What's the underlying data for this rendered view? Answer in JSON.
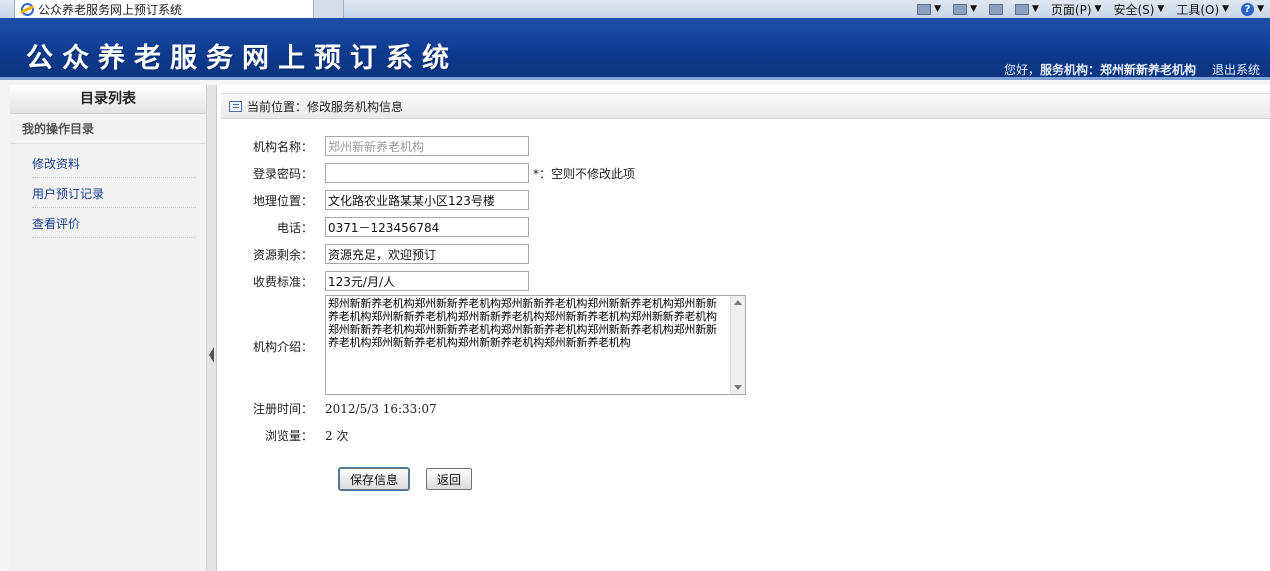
{
  "browser": {
    "tab_title": "公众养老服务网上预订系统",
    "menu": {
      "page": "页面(P)",
      "safety": "安全(S)",
      "tools": "工具(O)"
    }
  },
  "header": {
    "site_title": "公众养老服务网上预订系统",
    "greeting": "您好，",
    "user_role_name": "服务机构：郑州新新养老机构",
    "logout": "退出系统"
  },
  "sidebar": {
    "title": "目录列表",
    "section": "我的操作目录",
    "items": [
      "修改资料",
      "用户预订记录",
      "查看评价"
    ]
  },
  "breadcrumb": {
    "text": "当前位置：修改服务机构信息"
  },
  "form": {
    "name_label": "机构名称：",
    "name_value": "郑州新新养老机构",
    "password_label": "登录密码：",
    "password_value": "",
    "password_hint": "*：空则不修改此项",
    "address_label": "地理位置：",
    "address_value": "文化路农业路某某小区123号楼",
    "phone_label": "电话：",
    "phone_value": "0371－123456784",
    "resource_label": "资源剩余：",
    "resource_value": "资源充足，欢迎预订",
    "fee_label": "收费标准：",
    "fee_value": "123元/月/人",
    "intro_label": "机构介绍：",
    "intro_value": "郑州新新养老机构郑州新新养老机构郑州新新养老机构郑州新新养老机构郑州新新养老机构郑州新新养老机构郑州新新养老机构郑州新新养老机构郑州新新养老机构郑州新新养老机构郑州新新养老机构郑州新新养老机构郑州新新养老机构郑州新新养老机构郑州新新养老机构郑州新新养老机构郑州新新养老机构",
    "regtime_label": "注册时间：",
    "regtime_value": "2012/5/3 16:33:07",
    "views_label": "浏览量：",
    "views_value": "2 次",
    "save_label": "保存信息",
    "back_label": "返回"
  }
}
